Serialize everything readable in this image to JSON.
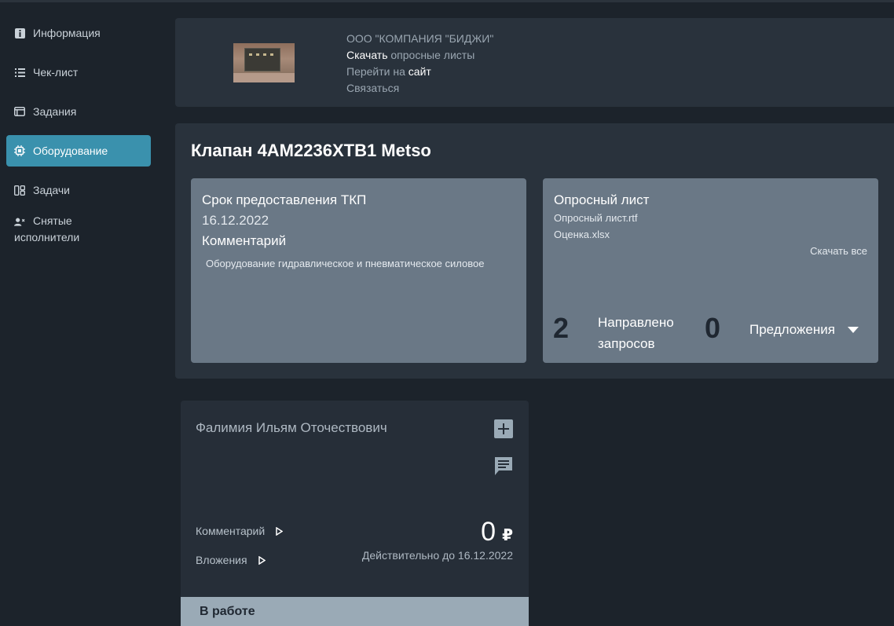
{
  "sidebar": {
    "items": [
      {
        "label": "Информация",
        "icon": "info-icon"
      },
      {
        "label": "Чек-лист",
        "icon": "checklist-icon"
      },
      {
        "label": "Задания",
        "icon": "tasks-window-icon"
      },
      {
        "label": "Оборудование",
        "icon": "chip-icon",
        "active": true
      },
      {
        "label": "Задачи",
        "icon": "board-icon"
      },
      {
        "label_line1": "Снятые",
        "label_line2": "исполнители",
        "icon": "user-remove-icon"
      }
    ]
  },
  "company": {
    "name": "ООО \"КОМПАНИЯ \"БИДЖИ\"",
    "download_strong": "Скачать",
    "download_rest": " опросные листы",
    "site_prefix": "Перейти на ",
    "site_strong": "сайт",
    "contact": "Связаться"
  },
  "equipment": {
    "title": "Клапан 4AM2236XTB1 Metso",
    "deadline_label": "Срок предоставления ТКП",
    "deadline_value": "16.12.2022",
    "comment_label": "Комментарий",
    "comment_text": "Оборудование гидравлическое и пневматическое силовое",
    "questionnaire": {
      "title": "Опросный лист",
      "files": [
        "Опросный лист.rtf",
        "Оценка.xlsx"
      ],
      "download_all": "Скачать все"
    },
    "requests_count": "2",
    "requests_label_line1": "Направлено",
    "requests_label_line2": "запросов",
    "offers_count": "0",
    "offers_label": "Предложения"
  },
  "proposal": {
    "name": "Фалимия Ильям Оточествович",
    "comment_link": "Комментарий",
    "attachments_link": "Вложения",
    "price": "0",
    "currency": "₽",
    "valid_until": "Действительно до 16.12.2022",
    "status": "В работе"
  },
  "colors": {
    "background": "#1c232b",
    "panel": "#29323c",
    "card": "#6a7886",
    "active_nav": "#3a91ad",
    "status_bar": "#9aaab6"
  }
}
